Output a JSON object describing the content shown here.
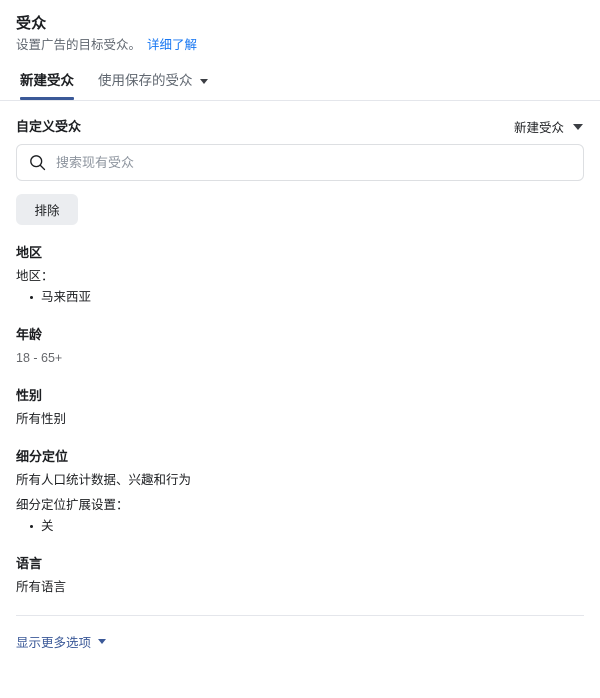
{
  "header": {
    "title": "受众",
    "subtitle": "设置广告的目标受众。",
    "learn_more": "详细了解"
  },
  "tabs": [
    {
      "label": "新建受众",
      "active": true
    },
    {
      "label": "使用保存的受众",
      "active": false,
      "icon": "chevron-down-icon"
    }
  ],
  "custom_audience": {
    "label": "自定义受众",
    "selector_value": "新建受众",
    "selector_icon": "chevron-down-icon",
    "search": {
      "placeholder": "搜索现有受众",
      "value": "",
      "icon": "search-icon"
    },
    "exclude_button": "排除"
  },
  "sections": [
    {
      "title": "地区",
      "lines": [
        "地区："
      ],
      "bullets": [
        "马来西亚"
      ]
    },
    {
      "title": "年龄",
      "lines": [
        "18 - 65+"
      ],
      "bullets": [],
      "muted": true
    },
    {
      "title": "性别",
      "lines": [
        "所有性别"
      ],
      "bullets": []
    },
    {
      "title": "细分定位",
      "lines": [
        "所有人口统计数据、兴趣和行为",
        "细分定位扩展设置："
      ],
      "bullets": [
        "关"
      ]
    },
    {
      "title": "语言",
      "lines": [
        "所有语言"
      ],
      "bullets": []
    }
  ],
  "footer": {
    "show_more_label": "显示更多选项",
    "show_more_icon": "chevron-down-icon"
  },
  "colors": {
    "link_blue": "#1877f2",
    "tab_active_underline": "#3b5998",
    "text_primary": "#1c1e21",
    "text_secondary": "#606770",
    "button_bg": "#ebedf0",
    "border": "#dddfe2",
    "divider": "#e4e6eb"
  }
}
